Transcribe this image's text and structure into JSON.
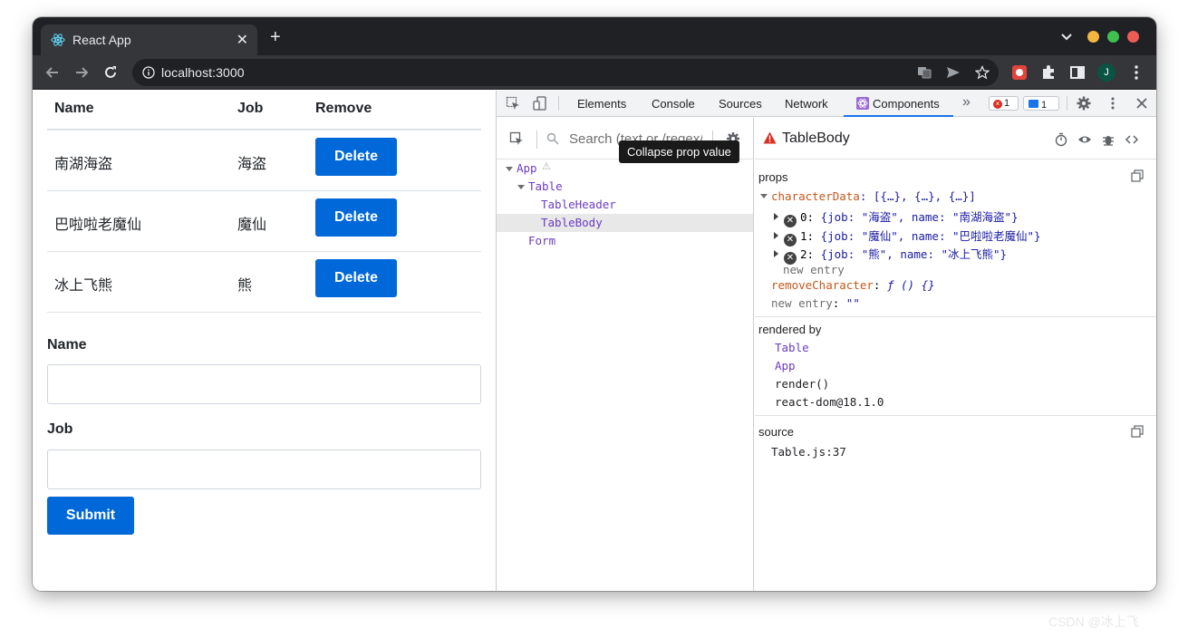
{
  "browser": {
    "tab_title": "React App",
    "tab_close": "✕",
    "new_tab": "+",
    "url": "localhost:3000",
    "avatar_letter": "J"
  },
  "page": {
    "headers": [
      "Name",
      "Job",
      "Remove"
    ],
    "rows": [
      {
        "name": "南湖海盗",
        "job": "海盗",
        "action": "Delete"
      },
      {
        "name": "巴啦啦老魔仙",
        "job": "魔仙",
        "action": "Delete"
      },
      {
        "name": "冰上飞熊",
        "job": "熊",
        "action": "Delete"
      }
    ],
    "form": {
      "name_label": "Name",
      "name_value": "",
      "job_label": "Job",
      "job_value": "",
      "submit_label": "Submit"
    }
  },
  "devtools": {
    "tabs": [
      "Elements",
      "Console",
      "Sources",
      "Network",
      "Components"
    ],
    "more": "»",
    "error_count": "1",
    "message_count": "1",
    "search_placeholder": "Search (text or /regex/)",
    "tree": [
      {
        "label": "App",
        "warning": "⚠"
      },
      {
        "label": "Table"
      },
      {
        "label": "TableHeader"
      },
      {
        "label": "TableBody"
      },
      {
        "label": "Form"
      }
    ],
    "selected_component": "TableBody",
    "tooltip": "Collapse prop value",
    "props_heading": "props",
    "props": {
      "characterData_key": "characterData",
      "characterData_value": "[{…}, {…}, {…}]",
      "items": [
        {
          "index": "0:",
          "value": "{job: \"海盗\", name: \"南湖海盗\"}"
        },
        {
          "index": "1:",
          "value": "{job: \"魔仙\", name: \"巴啦啦老魔仙\"}"
        },
        {
          "index": "2:",
          "value": "{job: \"熊\", name: \"冰上飞熊\"}"
        }
      ],
      "new_entry_inner": "new entry",
      "removeCharacter_key": "removeCharacter",
      "removeCharacter_value": "ƒ () {}",
      "new_entry_key": "new entry",
      "new_entry_value": "\"\""
    },
    "rendered_by_heading": "rendered by",
    "rendered_by": [
      "Table",
      "App",
      "render()",
      "react-dom@18.1.0"
    ],
    "source_heading": "source",
    "source_file": "Table.js:37"
  },
  "watermark": "CSDN @冰上飞",
  "colors": {
    "primary_button": "#0068d9",
    "devtools_accent": "#1a73e8",
    "prop_key": "#c5581b",
    "prop_value": "#1a1aa6",
    "component_name": "#6b3bc4"
  }
}
